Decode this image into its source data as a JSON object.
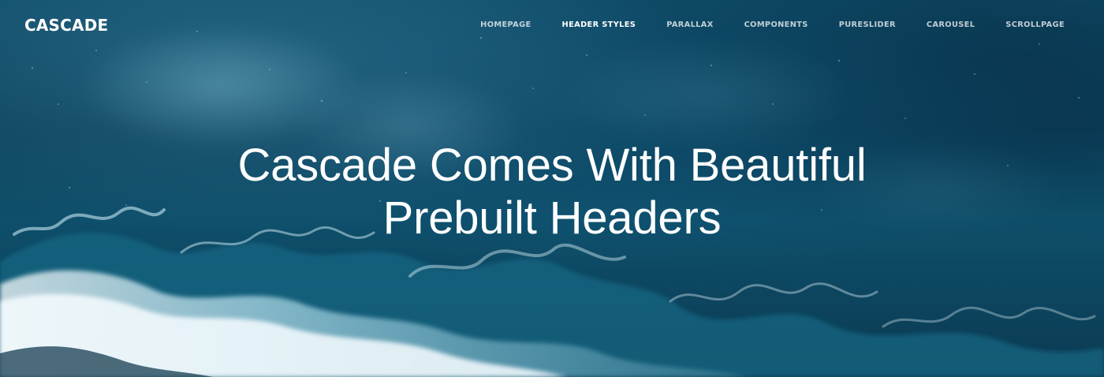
{
  "brand": {
    "name": "CASCADE"
  },
  "navigation": {
    "items": [
      {
        "label": "HOMEPAGE",
        "active": false
      },
      {
        "label": "HEADER STYLES",
        "active": true
      },
      {
        "label": "PARALLAX",
        "active": false
      },
      {
        "label": "COMPONENTS",
        "active": false
      },
      {
        "label": "PURESLIDER",
        "active": false
      },
      {
        "label": "CAROUSEL",
        "active": false
      },
      {
        "label": "SCROLLPAGE",
        "active": false
      }
    ]
  },
  "hero": {
    "headline_line_1": "Cascade Comes With Beautiful",
    "headline_line_2": "Prebuilt Headers",
    "background": "aerial-ocean-waves-photo",
    "colors": {
      "deep_water": "#0c3f5a",
      "surface_water": "#0f4c68",
      "foam": "#d8f3ff"
    }
  }
}
